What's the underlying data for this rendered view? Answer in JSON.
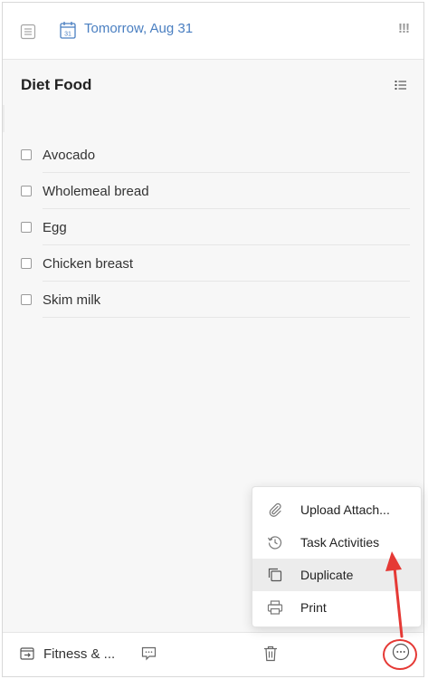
{
  "header": {
    "date": "Tomorrow, Aug 31",
    "calendar_day": "31",
    "priority": "!!!"
  },
  "task": {
    "title": "Diet Food",
    "items": [
      {
        "label": "Avocado"
      },
      {
        "label": "Wholemeal bread"
      },
      {
        "label": "Egg"
      },
      {
        "label": "Chicken breast"
      },
      {
        "label": "Skim milk"
      }
    ]
  },
  "menu": {
    "items": [
      {
        "label": "Upload Attach...",
        "icon": "paperclip-icon"
      },
      {
        "label": "Task Activities",
        "icon": "history-icon"
      },
      {
        "label": "Duplicate",
        "icon": "duplicate-icon",
        "highlighted": true
      },
      {
        "label": "Print",
        "icon": "printer-icon"
      }
    ]
  },
  "footer": {
    "list_name": "Fitness & ..."
  },
  "colors": {
    "accent": "#4a7fc1",
    "annotation": "#e53935",
    "highlight": "#ececec"
  }
}
